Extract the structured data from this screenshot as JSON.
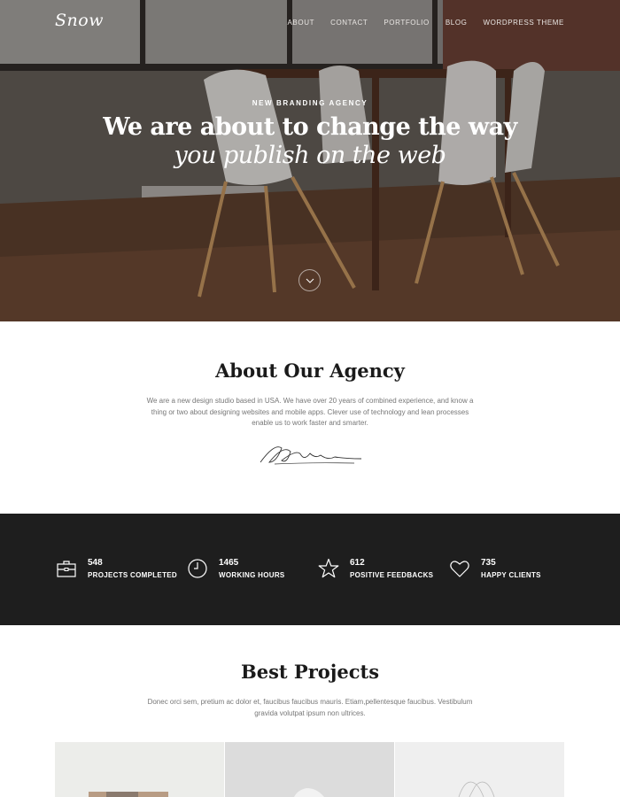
{
  "header": {
    "logo": "Snow",
    "nav": [
      "ABOUT",
      "CONTACT",
      "PORTFOLIO",
      "BLOG",
      "WORDPRESS THEME"
    ]
  },
  "hero": {
    "kicker": "NEW BRANDING AGENCY",
    "title": "We are about to change the way",
    "subtitle": "you publish on the web",
    "scroll_icon": "chevron-down-icon"
  },
  "about": {
    "title": "About Our Agency",
    "text": "We are a new design studio based in USA. We have over 20 years of combined experience, and know a thing or two about designing websites and mobile apps. Clever use of technology and lean processes enable us to work faster and smarter."
  },
  "stats": [
    {
      "icon": "briefcase-icon",
      "number": "548",
      "label": "PROJECTS COMPLETED"
    },
    {
      "icon": "clock-icon",
      "number": "1465",
      "label": "WORKING HOURS"
    },
    {
      "icon": "star-icon",
      "number": "612",
      "label": "POSITIVE FEEDBACKS"
    },
    {
      "icon": "heart-icon",
      "number": "735",
      "label": "HAPPY CLIENTS"
    }
  ],
  "projects": {
    "title": "Best Projects",
    "text": "Donec orci sem, pretium ac dolor et, faucibus faucibus mauris. Etiam,pellentesque faucibus. Vestibulum gravida volutpat ipsum non ultrices."
  },
  "colors": {
    "dark_band": "#1e1e1e",
    "text_gray": "#777777",
    "heading": "#1a1a1a"
  }
}
